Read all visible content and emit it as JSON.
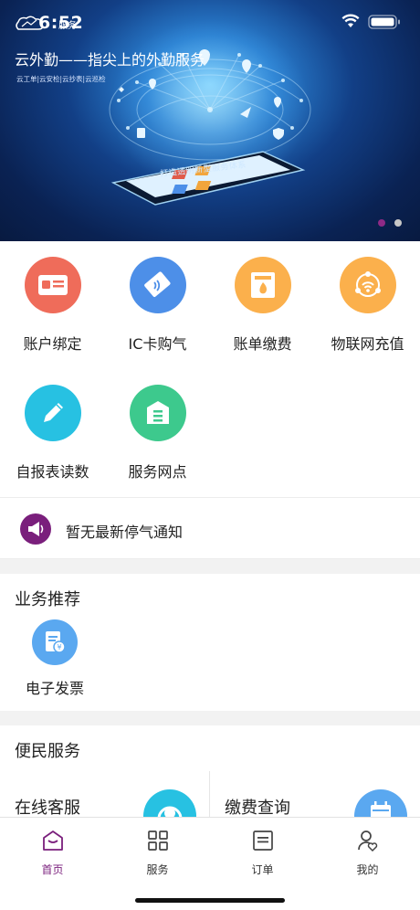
{
  "status": {
    "time": "6:52"
  },
  "banner": {
    "logo_text": "服务",
    "title": "云外勤——指尖上的外勤服务",
    "subtitle": "云工单|云安检|云抄表|云巡检",
    "phone_caption": "打造透明新型服务体系",
    "slides_total": 2,
    "slide_active": 1
  },
  "services": [
    {
      "label": "账户绑定",
      "icon": "id-card-icon",
      "color": "#ef6c5a"
    },
    {
      "label": "IC卡购气",
      "icon": "ic-card-icon",
      "color": "#4d8fe8"
    },
    {
      "label": "账单缴费",
      "icon": "bill-flame-icon",
      "color": "#fbb04c"
    },
    {
      "label": "物联网充值",
      "icon": "iot-signal-icon",
      "color": "#fbb04c"
    },
    {
      "label": "自报表读数",
      "icon": "pencil-icon",
      "color": "#27c1e2"
    },
    {
      "label": "服务网点",
      "icon": "service-point-icon",
      "color": "#3dc98d"
    }
  ],
  "notice": {
    "text": "暂无最新停气通知",
    "icon": "megaphone-icon"
  },
  "recommend": {
    "title": "业务推荐",
    "items": [
      {
        "label": "电子发票",
        "icon": "invoice-icon"
      }
    ]
  },
  "convenience": {
    "title": "便民服务",
    "items": [
      {
        "label": "在线客服",
        "icon": "customer-service-icon"
      },
      {
        "label": "缴费查询",
        "icon": "calendar-icon"
      }
    ]
  },
  "tabbar": {
    "items": [
      {
        "label": "首页",
        "icon": "home-icon",
        "active": true
      },
      {
        "label": "服务",
        "icon": "grid-icon",
        "active": false
      },
      {
        "label": "订单",
        "icon": "order-icon",
        "active": false
      },
      {
        "label": "我的",
        "icon": "profile-icon",
        "active": false
      }
    ]
  },
  "colors": {
    "accent": "#7a1f7c",
    "dot_inactive": "#c7c7c7"
  }
}
